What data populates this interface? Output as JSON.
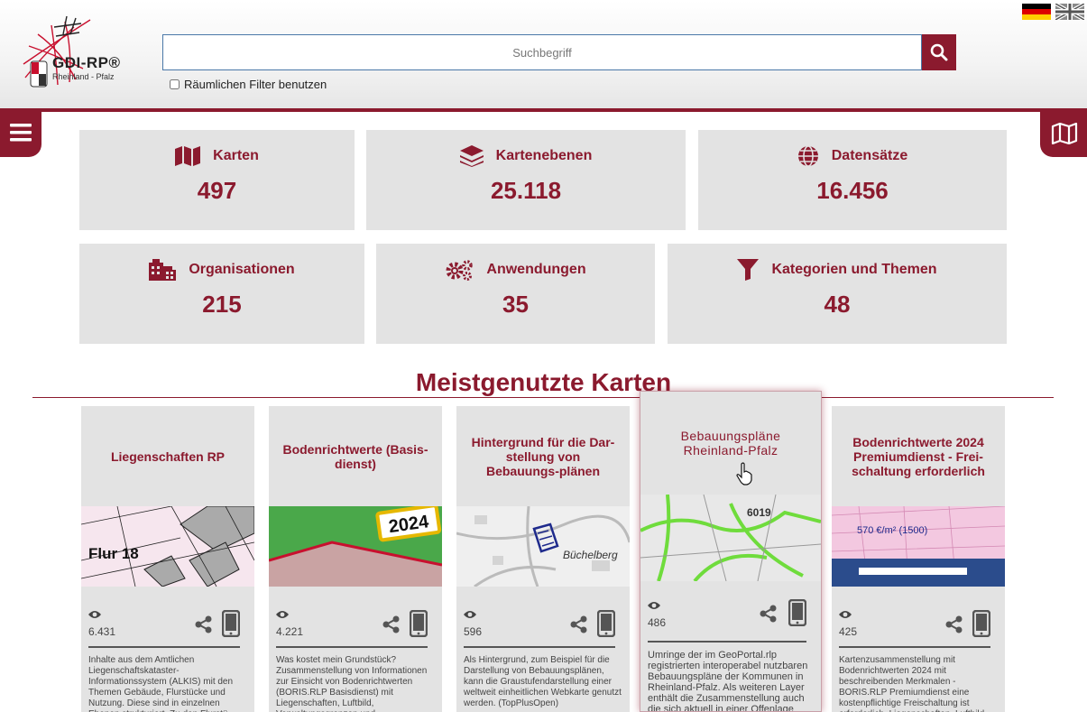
{
  "header": {
    "logo_text": "GDI-RP®",
    "logo_sub": "Rheinland - Pfalz",
    "search_placeholder": "Suchbegriff",
    "spatial_filter_label": "Räumlichen Filter benutzen"
  },
  "stats": [
    {
      "label": "Karten",
      "value": "497",
      "icon": "map-icon"
    },
    {
      "label": "Kartenebenen",
      "value": "25.118",
      "icon": "layers-icon"
    },
    {
      "label": "Datensätze",
      "value": "16.456",
      "icon": "globe-icon"
    },
    {
      "label": "Organisationen",
      "value": "215",
      "icon": "building-icon"
    },
    {
      "label": "Anwendungen",
      "value": "35",
      "icon": "gears-icon"
    },
    {
      "label": "Kategorien und Themen",
      "value": "48",
      "icon": "filter-icon"
    }
  ],
  "section_title": "Meistgenutzte Karten",
  "cards": [
    {
      "title": "Liegenschaften RP",
      "views": "6.431",
      "description": "Inhalte aus dem Amtlichen Liegenschaftskataster-Informationssystem (ALKIS) mit den Themen Gebäude, Flurstücke und Nutzung. Diese sind in einzelnen Ebenen strukturiert. Zu den Flurstü",
      "map_label": "Flur 18"
    },
    {
      "title": "Bodenrichtwerte (Basis-dienst)",
      "views": "4.221",
      "description": "Was kostet mein Grundstück? Zusammenstellung von Informationen zur Einsicht von Bodenrichtwerten (BORIS.RLP Basisdienst) mit Liegenschaften, Luftbild, Verwaltungsgrenzen und Generalisierten Bodenricht",
      "map_label": "2024"
    },
    {
      "title": "Hintergrund für die Dar-stellung von Bebauungs-plänen",
      "views": "596",
      "description": "Als Hintergrund, zum Beispiel für die Darstellung von Bebauungsplänen, kann die Graustufendarstellung einer weltweit einheitlichen Webkarte genutzt werden. (TopPlusOpen)",
      "map_label": "Büchelberg"
    },
    {
      "title": "Bebauungspläne Rheinland-Pfalz",
      "views": "486",
      "description": "Umringe der im GeoPortal.rlp registrierten interoperabel nutzbaren Bebauungspläne der Kommunen in Rheinland-Pfalz. Als weiteren Layer enthält die Zusammenstellung auch die sich aktuell in einer Offenlage",
      "map_label": "6019"
    },
    {
      "title": "Bodenrichtwerte 2024 Premiumdienst - Frei-schaltung erforderlich",
      "views": "425",
      "description": "Kartenzusammenstellung mit Bodenrichtwerten 2024 mit beschreibenden Merkmalen - BORIS.RLP Premiumdienst eine kostenpflichtige Freischaltung ist erforderlich, Liegenschaften, Luftbild, Verwaltungsgrenzen und",
      "map_label": "570 €/m² (1500)"
    }
  ],
  "colors": {
    "accent": "#8b1a2e",
    "tile_bg": "#e3e3e3"
  }
}
